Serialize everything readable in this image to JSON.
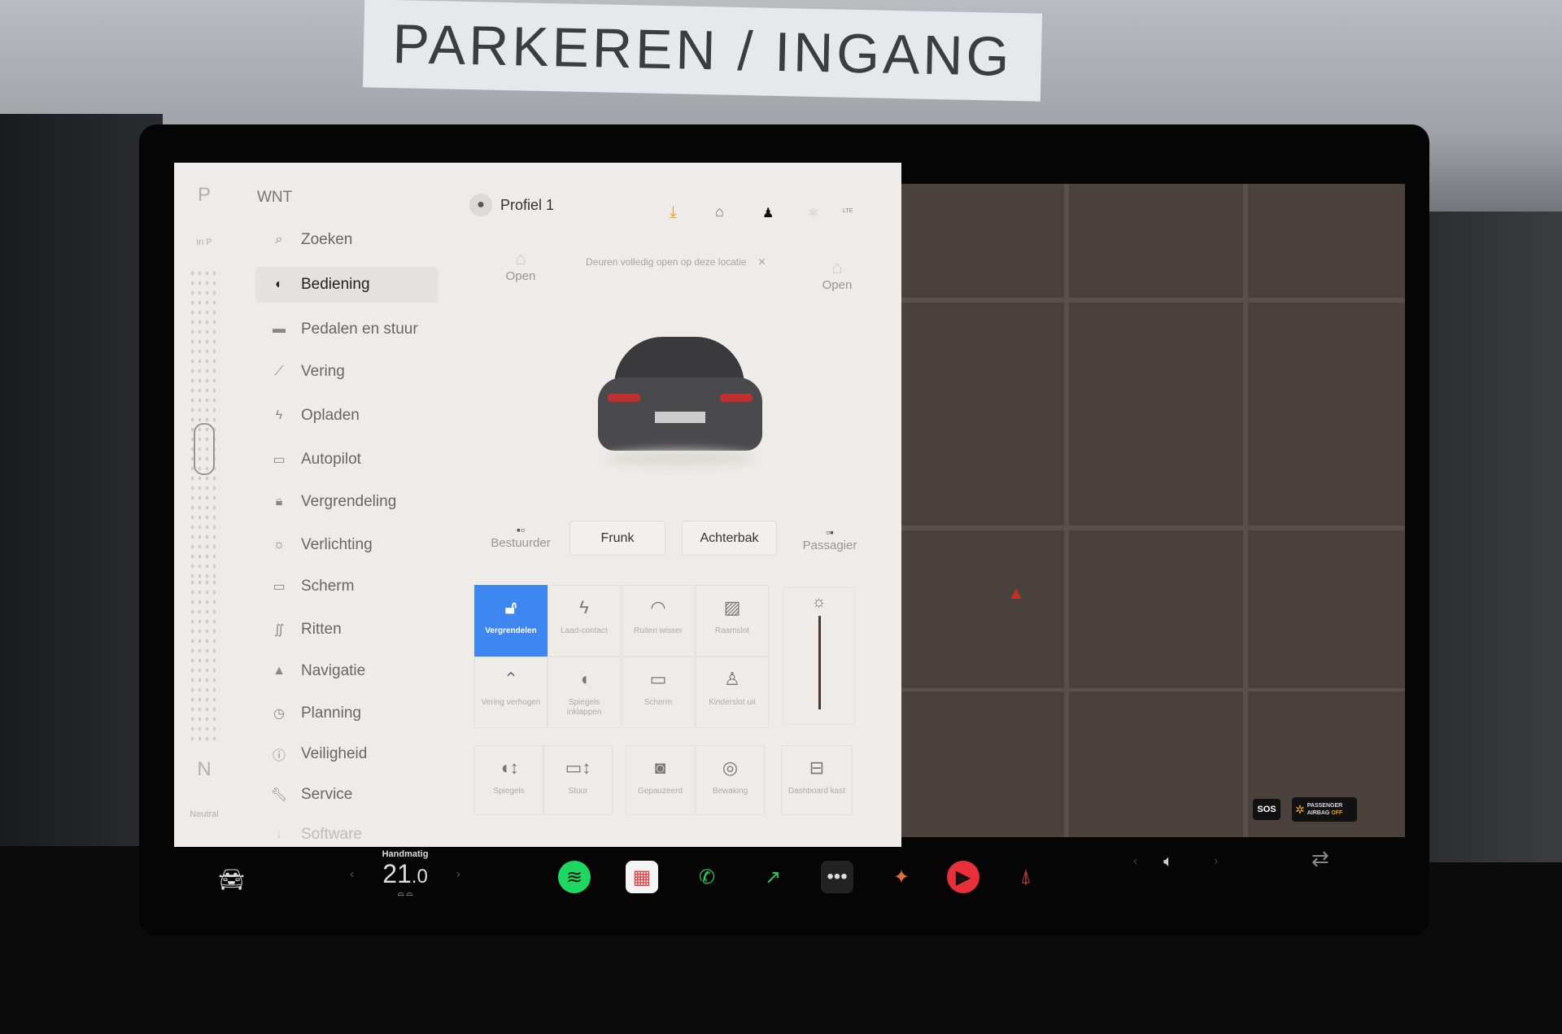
{
  "background": {
    "sign_text": "PARKEREN / INGANG"
  },
  "gear": {
    "top": "P",
    "top_label": "In P",
    "bottom": "N",
    "bottom_label": "Neutral"
  },
  "sidebar": {
    "title": "WNT",
    "items": [
      {
        "label": "Zoeken",
        "icon": "search-icon",
        "glyph": "⌕"
      },
      {
        "label": "Bediening",
        "icon": "toggle-icon",
        "glyph": "◐",
        "selected": true
      },
      {
        "label": "Pedalen en stuur",
        "icon": "car-icon",
        "glyph": "▬"
      },
      {
        "label": "Vering",
        "icon": "suspension-icon",
        "glyph": "⟋"
      },
      {
        "label": "Opladen",
        "icon": "bolt-icon",
        "glyph": "ϟ"
      },
      {
        "label": "Autopilot",
        "icon": "steering-icon",
        "glyph": "▭"
      },
      {
        "label": "Vergrendeling",
        "icon": "lock-icon",
        "glyph": "🔒︎"
      },
      {
        "label": "Verlichting",
        "icon": "sun-icon",
        "glyph": "☼"
      },
      {
        "label": "Scherm",
        "icon": "screen-icon",
        "glyph": "▭"
      },
      {
        "label": "Ritten",
        "icon": "trips-icon",
        "glyph": "∬"
      },
      {
        "label": "Navigatie",
        "icon": "navigation-icon",
        "glyph": "▲"
      },
      {
        "label": "Planning",
        "icon": "clock-icon",
        "glyph": "◷"
      },
      {
        "label": "Veiligheid",
        "icon": "alert-icon",
        "glyph": "ⓘ"
      },
      {
        "label": "Service",
        "icon": "wrench-icon",
        "glyph": "🔧︎"
      },
      {
        "label": "Software",
        "icon": "download-icon",
        "glyph": "↓"
      }
    ]
  },
  "header": {
    "profile": "Profiel 1",
    "icons": [
      "download-icon",
      "garage-icon",
      "bell-icon",
      "bluetooth-icon",
      "lte-signal-icon"
    ],
    "lte": "LTE",
    "download_color": "#f0a020"
  },
  "car": {
    "notice": "Deuren volledig open op deze locatie",
    "door_left": "Open",
    "door_right": "Open",
    "driver": "Bestuurder",
    "passenger": "Passagier",
    "frunk": "Frunk",
    "trunk": "Achterbak"
  },
  "controls": {
    "accent": "#3e87f0",
    "tiles": [
      {
        "label": "Vergrendelen",
        "icon": "unlock-icon",
        "glyph": "🔓︎",
        "active": true
      },
      {
        "label": "Laad-contact",
        "icon": "bolt-icon",
        "glyph": "ϟ"
      },
      {
        "label": "Ruiten wisser",
        "icon": "wiper-icon",
        "glyph": "◠"
      },
      {
        "label": "Raamslot",
        "icon": "window-lock-icon",
        "glyph": "▨"
      },
      {
        "label": "Vering verhogen",
        "icon": "raise-suspension-icon",
        "glyph": "⌃"
      },
      {
        "label": "Spiegels inklappen",
        "icon": "mirror-fold-icon",
        "glyph": "◖"
      },
      {
        "label": "Scherm",
        "icon": "screen-icon",
        "glyph": "▭"
      },
      {
        "label": "Kinderslot uit",
        "icon": "child-lock-icon",
        "glyph": "♙"
      }
    ],
    "brightness_level": 1.0,
    "bottom": [
      {
        "label": "Spiegels",
        "icon": "mirror-adjust-icon",
        "glyph": "◖↕"
      },
      {
        "label": "Stuur",
        "icon": "steering-adjust-icon",
        "glyph": "▭↕"
      },
      {
        "label": "Gepauzeerd",
        "icon": "dashcam-icon",
        "glyph": "◙"
      },
      {
        "label": "Bewaking",
        "icon": "sentry-icon",
        "glyph": "◎"
      },
      {
        "label": "Dashboard kast",
        "icon": "glovebox-icon",
        "glyph": "⊟"
      }
    ]
  },
  "map": {
    "sos": "SOS",
    "airbag_line1": "PASSENGER",
    "airbag_line2": "AIRBAG",
    "airbag_state": "OFF"
  },
  "taskbar": {
    "climate_mode": "Handmatig",
    "temperature": "21",
    "temperature_decimal": ".0",
    "apps": [
      {
        "icon": "spotify-icon",
        "glyph": "≋",
        "color": "#1ed760"
      },
      {
        "icon": "calendar-icon",
        "glyph": "▦",
        "color": "#ffffff"
      },
      {
        "icon": "phone-icon",
        "glyph": "✆",
        "color": "#2bd15b"
      },
      {
        "icon": "energy-icon",
        "glyph": "↗",
        "color": "#2fc75a"
      },
      {
        "icon": "more-icon",
        "glyph": "•••",
        "color": "#222"
      },
      {
        "icon": "toybox-icon",
        "glyph": "✦",
        "color": "#e07030"
      },
      {
        "icon": "media-icon",
        "glyph": "▶",
        "color": "#e8303a"
      },
      {
        "icon": "joystick-icon",
        "glyph": "⍋",
        "color": "#d04040"
      }
    ]
  }
}
